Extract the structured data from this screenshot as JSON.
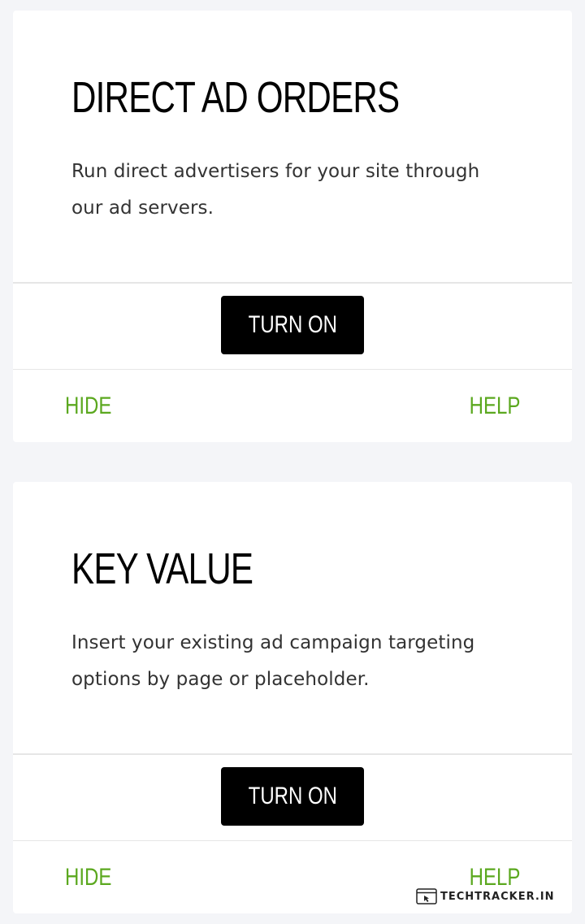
{
  "cards": [
    {
      "title": "DIRECT AD ORDERS",
      "description": "Run direct advertisers for your site through our ad servers.",
      "action_label": "TURN ON",
      "hide_label": "HIDE",
      "help_label": "HELP"
    },
    {
      "title": "KEY VALUE",
      "description": "Insert your existing ad campaign targeting options by page or placeholder.",
      "action_label": "TURN ON",
      "hide_label": "HIDE",
      "help_label": "HELP"
    }
  ],
  "watermark": {
    "text": "TECHTRACKER.IN",
    "icon": "browser-window-icon"
  },
  "colors": {
    "background": "#f4f5f8",
    "card": "#ffffff",
    "button": "#000000",
    "button_text": "#ffffff",
    "link": "#5ba81f",
    "title": "#000000",
    "description": "#333333"
  }
}
